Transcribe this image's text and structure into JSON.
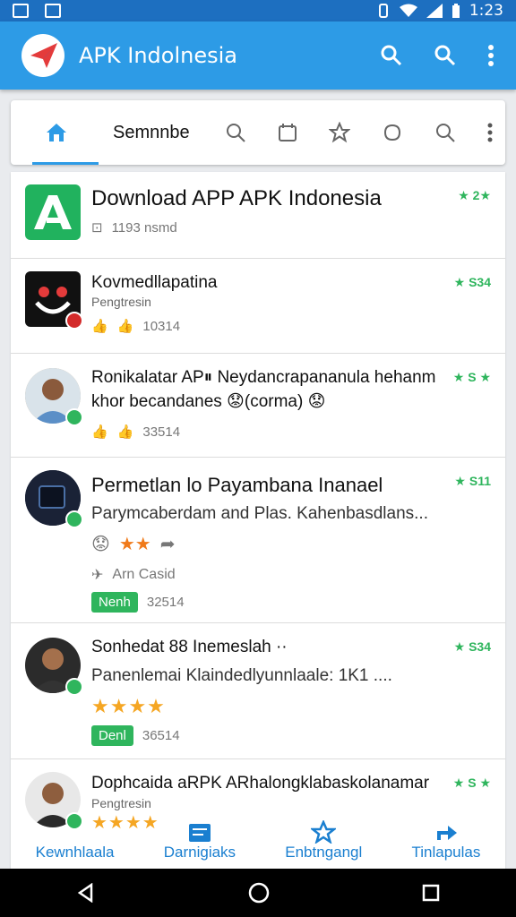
{
  "status_bar": {
    "time": "1:23"
  },
  "app_bar": {
    "title": "APK Indolnesia"
  },
  "tabs": {
    "label": "Semnnbe"
  },
  "list": [
    {
      "name": "Download APP APK Indonesia",
      "sub": "1193 nsmd",
      "rating": "★ 2★"
    },
    {
      "name": "Kovmedllapatina",
      "sub": "Pengtresin",
      "meta": "10314",
      "rating": "★ S34"
    },
    {
      "name_line1": "Ronikalatar AP⏸ Neydancrapananula hehanm",
      "name_line2": "khor becandanes 😟(corma) 😟",
      "meta": "33514",
      "rating": "★ S ★"
    },
    {
      "name": "Permetlan lo Payambana Inanael",
      "desc": "Parymcaberdam and Plas. Kahenbasdlans...",
      "tag": "Arn Casid",
      "pill": "Nenh",
      "meta": "32514",
      "rating": "★ S11"
    },
    {
      "name": "Sonhedat 88 Inemeslah ··",
      "desc": "Panenlemai Klaindedlyunnlaale: 1K1 ....",
      "pill": "Denl",
      "meta": "36514",
      "rating": "★ S34"
    },
    {
      "name": "Dophcaida aRPK ARhalongklabaskolanamar",
      "sub": "Pengtresin",
      "rating": "★ S ★"
    }
  ],
  "bottom_nav": [
    "Kewnhlaala",
    "Darnigiaks",
    "Enbtngangl",
    "Tinlapulas"
  ],
  "colors": {
    "status_bar": "#1d6fc0",
    "app_bar": "#2d9be6",
    "accent_green": "#2fb55d",
    "nav_blue": "#1a7fd0"
  }
}
